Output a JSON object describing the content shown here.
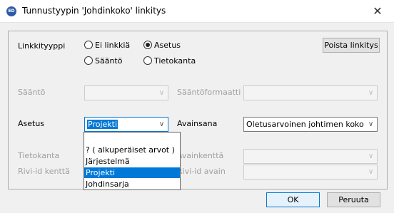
{
  "window": {
    "title": "Tunnustyypin 'Johdinkoko' linkitys",
    "app_icon_text": "ED",
    "close_glyph": "✕"
  },
  "link_type": {
    "label": "Linkkityyppi",
    "options": [
      {
        "label": "Ei linkkiä",
        "checked": false
      },
      {
        "label": "Asetus",
        "checked": true
      },
      {
        "label": "Sääntö",
        "checked": false
      },
      {
        "label": "Tietokanta",
        "checked": false
      }
    ]
  },
  "remove_button": "Poista linkitys",
  "rule": {
    "label": "Sääntö",
    "value": ""
  },
  "rule_format": {
    "label": "Sääntöformaatti",
    "value": ""
  },
  "setting": {
    "label": "Asetus",
    "value": "Projekti"
  },
  "key_name": {
    "label": "Avainsana",
    "value": "Oletusarvoinen johtimen koko"
  },
  "database": {
    "label": "Tietokanta",
    "value": ""
  },
  "key_field": {
    "label": "Avainkenttä",
    "label_visible": "Avainkenttä"
  },
  "row_id_field": {
    "label": "Rivi-id kenttä",
    "value": ""
  },
  "row_id_key": {
    "label": "Rivi-id avain"
  },
  "dropdown": {
    "options": [
      "?  ( alkuperäiset arvot )",
      "Järjestelmä",
      "Projekti",
      "Johdinsarja"
    ],
    "selected": "Projekti"
  },
  "footer": {
    "ok": "OK",
    "cancel": "Peruuta"
  }
}
